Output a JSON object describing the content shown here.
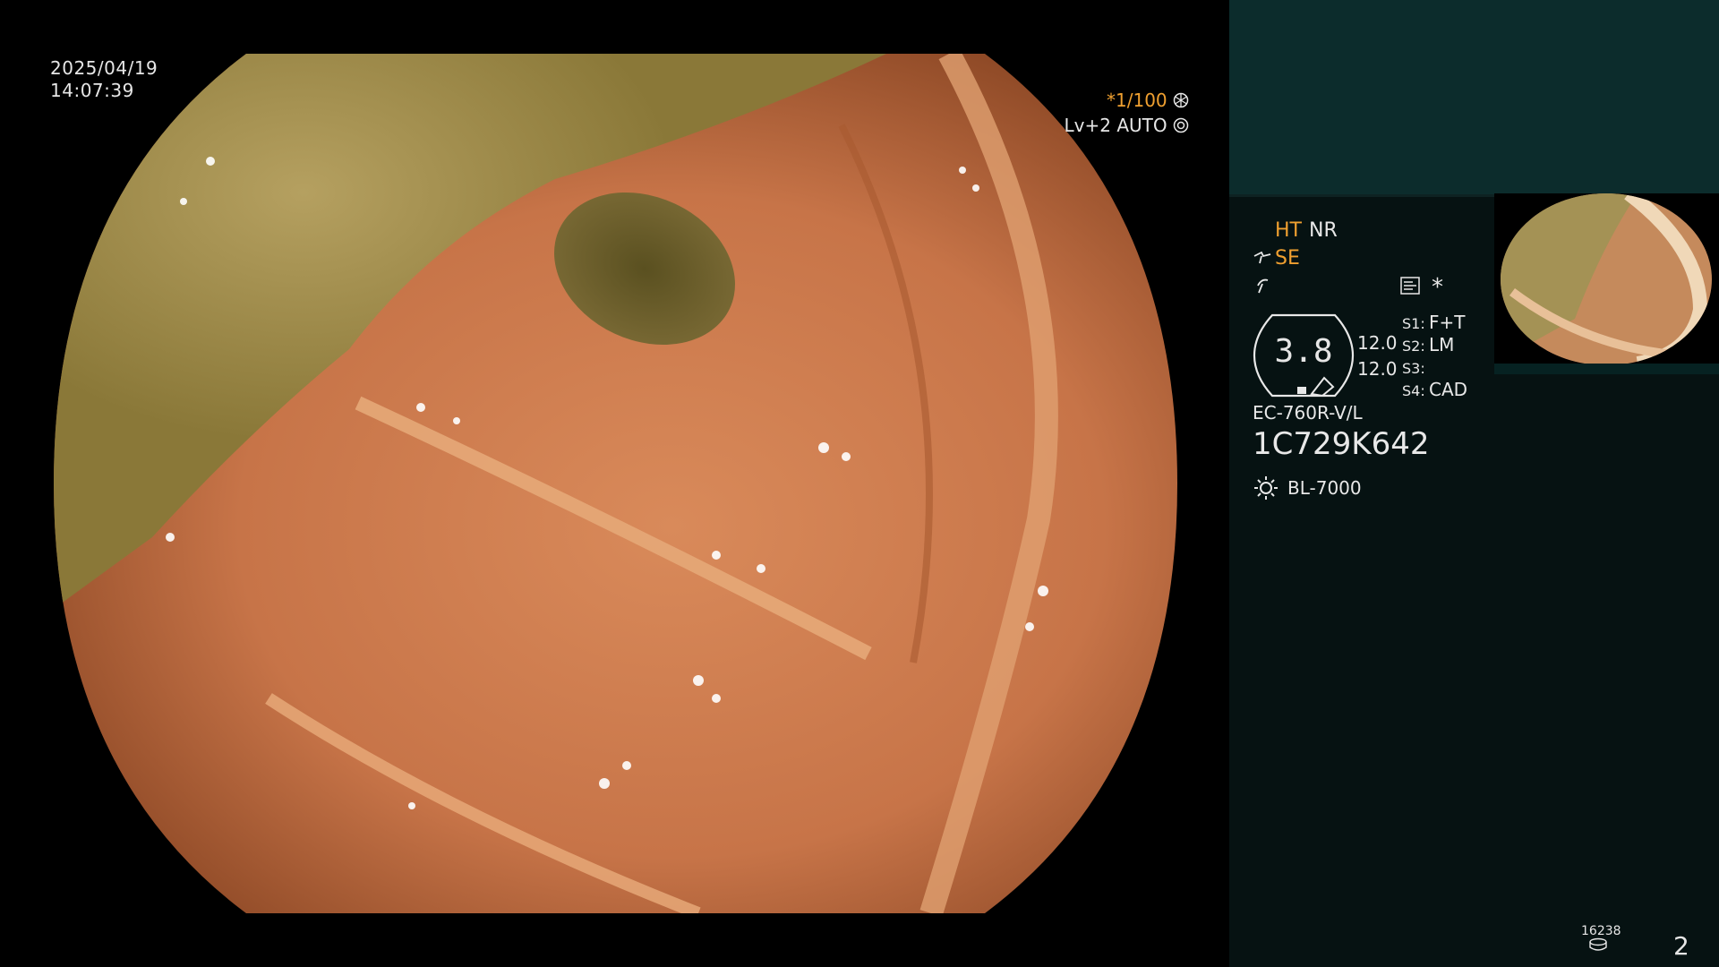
{
  "overlay": {
    "date": "2025/04/19",
    "time": "14:07:39",
    "shutter_speed": "*1/100",
    "level": "Lv+2 AUTO"
  },
  "panel": {
    "ht": "HT",
    "nr": "NR",
    "se": "SE",
    "s1_label": "S1:",
    "s1_value": "F+T",
    "s2_label": "S2:",
    "s2_value": "LM",
    "s3_label": "S3:",
    "s3_value": "",
    "s4_label": "S4:",
    "s4_value": "CAD",
    "gauge_value": "3.8",
    "value_top": "12.0",
    "value_bottom": "12.0",
    "asterisk": "*",
    "scope_model": "EC-760R-V/L",
    "scope_serial": "1C729K642",
    "light_source": "BL-7000",
    "storage_count": "16238",
    "page_number": "2"
  },
  "icons": {
    "shutter": "aperture-icon",
    "level": "iris-icon",
    "se": "scope-icon",
    "flash": "lightning-icon",
    "menu": "memory-icon",
    "light": "sun-icon",
    "storage": "disk-icon"
  },
  "colors": {
    "accent_orange": "#f0a030",
    "panel_bg": "#061212",
    "panel_top_bg": "#0c2c2c"
  }
}
